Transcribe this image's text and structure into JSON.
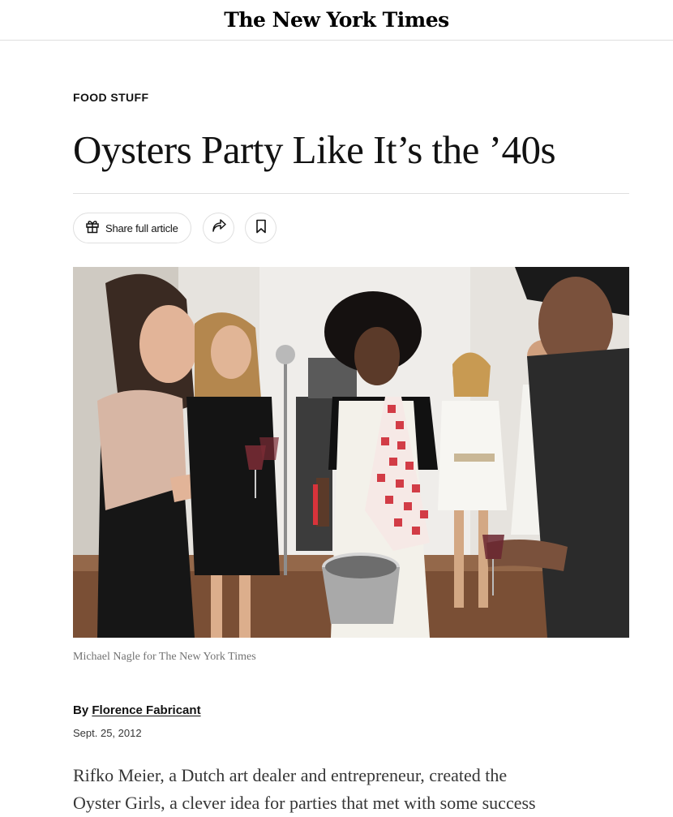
{
  "masthead": {
    "logo_text": "The New York Times"
  },
  "article": {
    "kicker": "FOOD STUFF",
    "headline": "Oysters Party Like It’s the ’40s",
    "toolbar": {
      "share_label": "Share full article",
      "gift_icon": "gift-icon",
      "forward_icon": "share-arrow-icon",
      "save_icon": "bookmark-icon"
    },
    "image": {
      "credit": "Michael Nagle for The New York Times"
    },
    "byline": {
      "prefix": "By",
      "author": "Florence Fabricant"
    },
    "date": "Sept. 25, 2012",
    "body": {
      "line1": "Rifko Meier, a Dutch art dealer and entrepreneur, created the",
      "line2": "Oyster Girls, a clever idea for parties that met with some success"
    }
  },
  "colors": {
    "text": "#121212",
    "secondary_text": "#363636",
    "caption": "#727272",
    "rule": "#dfdfdf",
    "apron_check": "#d23c46"
  }
}
